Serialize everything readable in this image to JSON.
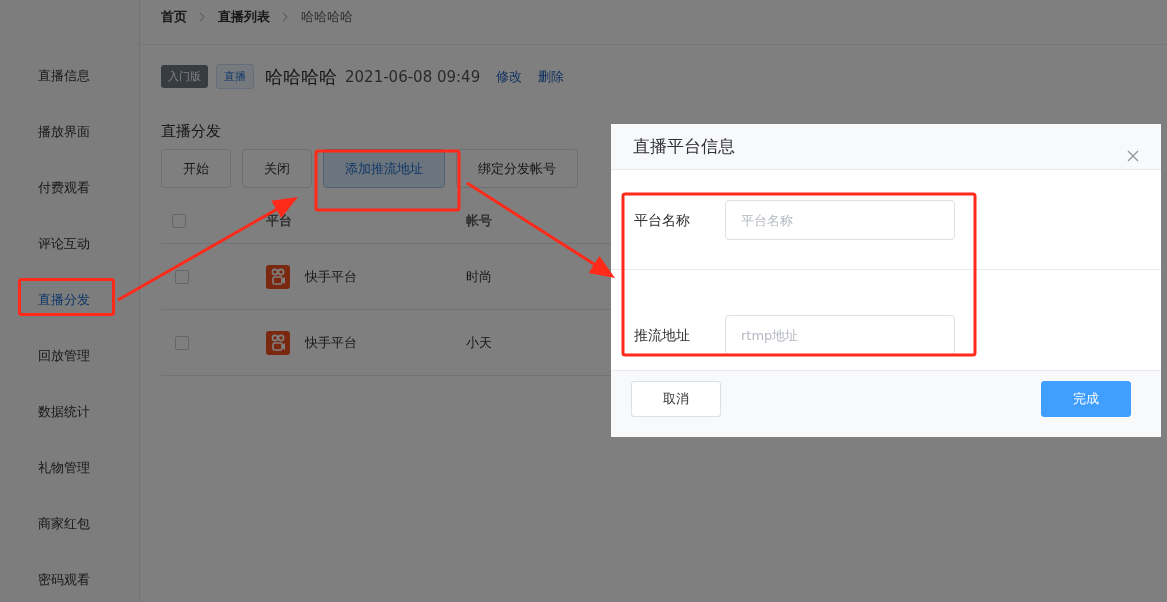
{
  "sidebar": {
    "items": [
      {
        "label": "直播信息",
        "selected": false
      },
      {
        "label": "播放界面",
        "selected": false
      },
      {
        "label": "付费观看",
        "selected": false
      },
      {
        "label": "评论互动",
        "selected": false
      },
      {
        "label": "直播分发",
        "selected": true
      },
      {
        "label": "回放管理",
        "selected": false
      },
      {
        "label": "数据统计",
        "selected": false
      },
      {
        "label": "礼物管理",
        "selected": false
      },
      {
        "label": "商家红包",
        "selected": false
      },
      {
        "label": "密码观看",
        "selected": false
      }
    ]
  },
  "breadcrumb": [
    {
      "label": "首页",
      "current": false
    },
    {
      "label": "直播列表",
      "current": false
    },
    {
      "label": "哈哈哈哈",
      "current": true
    }
  ],
  "live": {
    "badges": [
      {
        "label": "入门版",
        "kind": "plan"
      },
      {
        "label": "直播",
        "kind": "type"
      }
    ],
    "title": "哈哈哈哈",
    "time": "2021-06-08 09:49",
    "actions": [
      "修改",
      "删除"
    ]
  },
  "section_title": "直播分发",
  "buttons": [
    {
      "label": "开始",
      "focused": false
    },
    {
      "label": "关闭",
      "focused": false
    },
    {
      "label": "添加推流地址",
      "focused": true
    },
    {
      "label": "绑定分发帐号",
      "focused": false
    }
  ],
  "table": {
    "columns": [
      "平台",
      "帐号"
    ],
    "header_checked": false,
    "rows": [
      {
        "checked": false,
        "platform": "快手平台",
        "account": "时尚"
      },
      {
        "checked": false,
        "platform": "快手平台",
        "account": "小天"
      }
    ]
  },
  "dialog": {
    "title": "直播平台信息",
    "fields": [
      {
        "label": "平台名称",
        "placeholder": "平台名称"
      },
      {
        "label": "推流地址",
        "placeholder": "rtmp地址"
      }
    ],
    "buttons": [
      {
        "label": "取消",
        "kind": "default"
      },
      {
        "label": "完成",
        "kind": "primary"
      }
    ]
  }
}
